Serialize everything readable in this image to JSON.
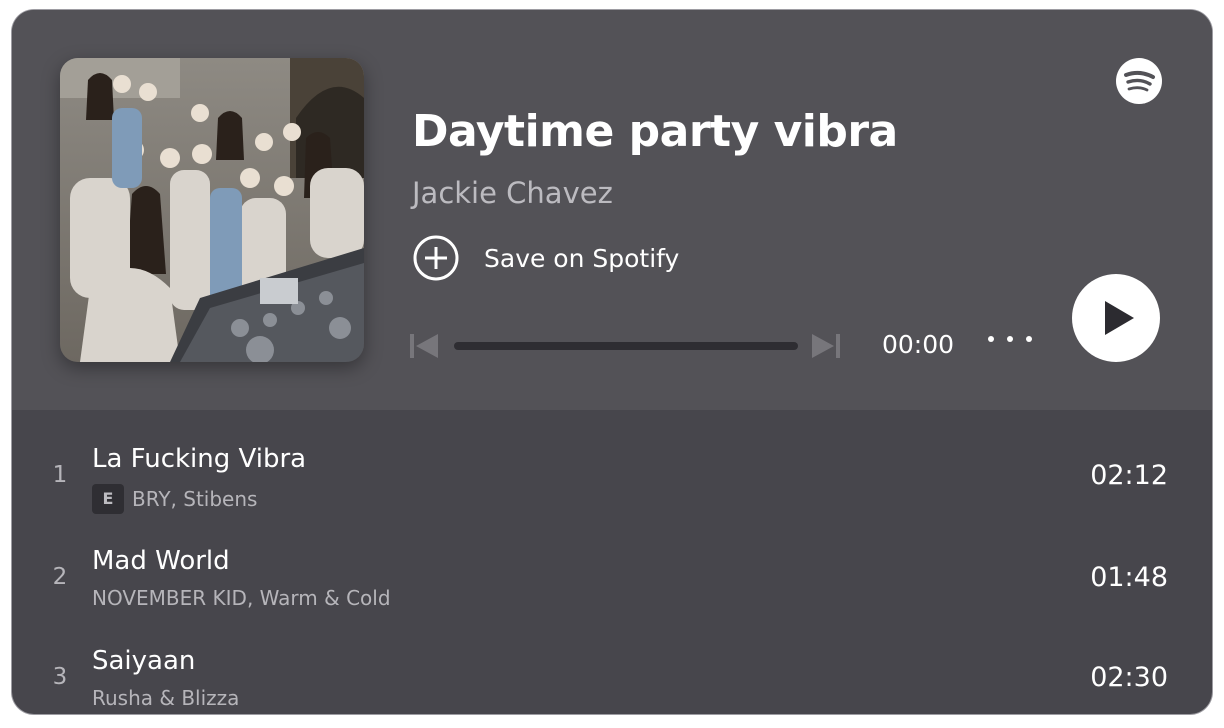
{
  "playlist": {
    "title": "Daytime party vibra",
    "owner": "Jackie Chavez",
    "save_label": "Save on Spotify"
  },
  "player": {
    "time": "00:00",
    "progress_fraction": 0
  },
  "tracks": [
    {
      "number": "1",
      "name": "La Fucking Vibra",
      "explicit_badge": "E",
      "artists": "BRY, Stibens",
      "duration": "02:12"
    },
    {
      "number": "2",
      "name": "Mad World",
      "artists": "NOVEMBER KID, Warm & Cold",
      "duration": "01:48"
    },
    {
      "number": "3",
      "name": "Saiyaan",
      "artists": "Rusha & Blizza",
      "duration": "02:30"
    }
  ],
  "icons": {
    "logo": "spotify-logo-icon",
    "save": "plus-circle-icon",
    "previous": "skip-back-icon",
    "next": "skip-forward-icon",
    "more": "more-options-icon",
    "play": "play-icon"
  },
  "colors": {
    "header_background": "#535257",
    "list_background": "#47464c",
    "text_primary": "#ffffff",
    "text_secondary": "#b6b5ba"
  }
}
